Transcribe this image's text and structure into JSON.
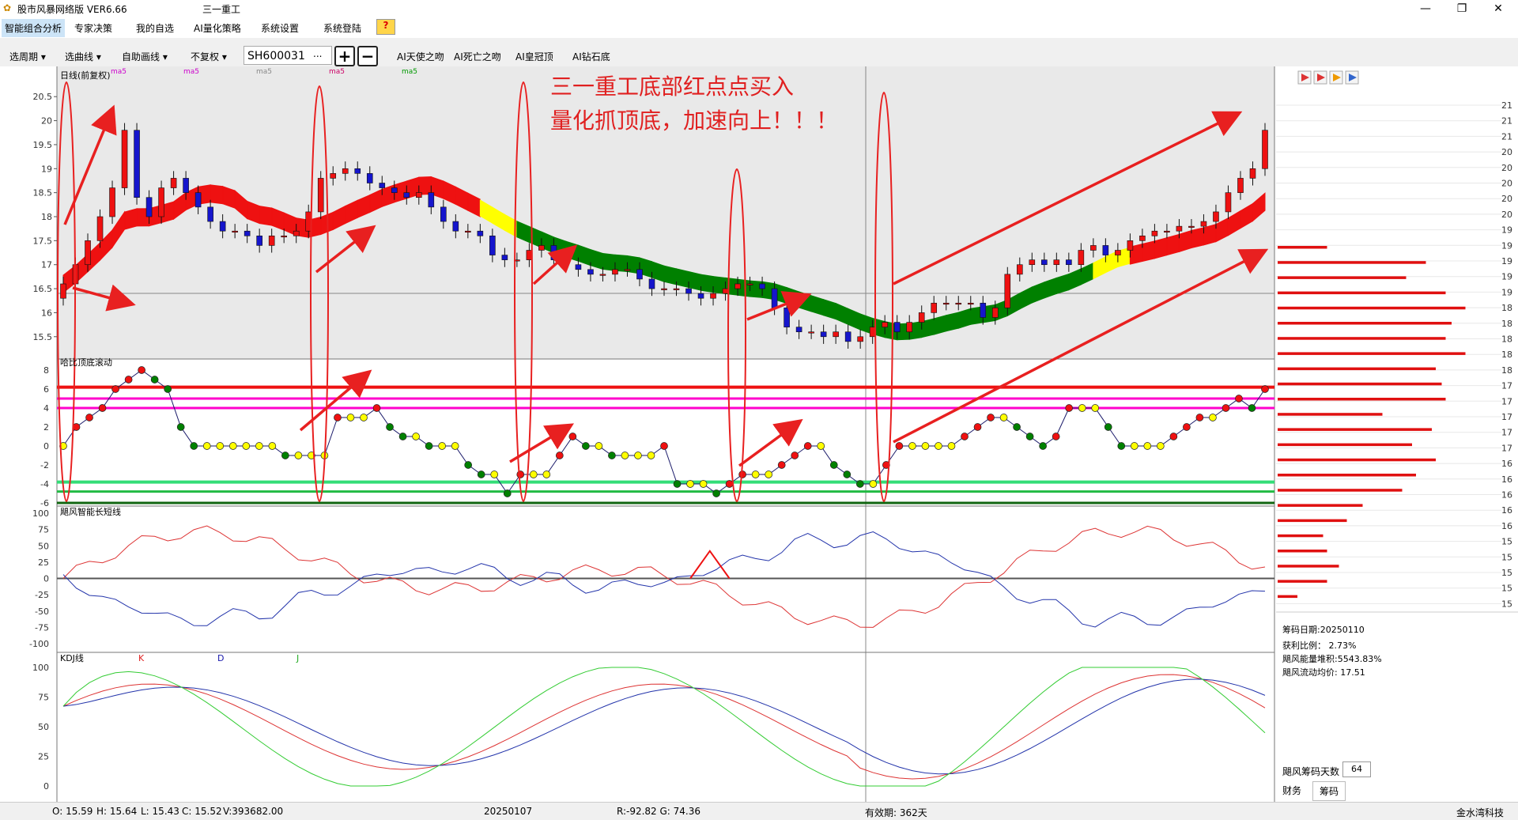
{
  "window": {
    "app_title": "股市风暴网络版 VER6.66",
    "doc_title": "三一重工",
    "min_glyph": "—",
    "max_glyph": "❐",
    "close_glyph": "✕"
  },
  "menu": {
    "items": [
      "智能组合分析",
      "专家决策",
      "我的自选",
      "AI量化策略",
      "系统设置",
      "系统登陆"
    ],
    "help": "?"
  },
  "toolbar": {
    "period": "选周期",
    "curve": "选曲线",
    "auto_draw": "自助画线",
    "adjust": "不复权",
    "stock_code": "SH600031",
    "more": "...",
    "plus": "+",
    "minus": "−",
    "ai_items": [
      "AI天使之吻",
      "AI死亡之吻",
      "AI皇冠顶",
      "AI钻石底"
    ],
    "dropdown_glyph": "▾"
  },
  "colors": {
    "red": "#ee1111",
    "green": "#008000",
    "yellow": "#ffff00",
    "blue": "#1515cc",
    "magenta": "#ff00cc",
    "accent": "#e02020"
  },
  "annotation": {
    "line1": "三一重工底部红点点买入",
    "line2": "量化抓顶底，加速向上！！！"
  },
  "chart_data": [
    {
      "type": "candlestick",
      "title": "日线(前复权)",
      "indicator_labels": [
        "ma5",
        "ma5",
        "ma5",
        "ma5",
        "ma5"
      ],
      "yticks": [
        "20.5",
        "20",
        "19.5",
        "19",
        "18.5",
        "18",
        "17.5",
        "17",
        "16.5",
        "16",
        "15.5"
      ],
      "ylim": [
        15.2,
        20.8
      ],
      "close": [
        16.6,
        17.0,
        17.5,
        18.0,
        18.6,
        19.8,
        18.4,
        18.0,
        18.6,
        18.8,
        18.5,
        18.2,
        17.9,
        17.7,
        17.7,
        17.6,
        17.4,
        17.6,
        17.6,
        17.7,
        18.1,
        18.8,
        18.9,
        19.0,
        18.9,
        18.7,
        18.6,
        18.5,
        18.4,
        18.5,
        18.2,
        17.9,
        17.7,
        17.7,
        17.6,
        17.2,
        17.1,
        17.1,
        17.3,
        17.4,
        17.1,
        17.0,
        16.9,
        16.8,
        16.8,
        16.9,
        16.9,
        16.7,
        16.5,
        16.5,
        16.5,
        16.4,
        16.3,
        16.4,
        16.5,
        16.6,
        16.6,
        16.5,
        16.1,
        15.7,
        15.6,
        15.6,
        15.5,
        15.6,
        15.4,
        15.5,
        15.7,
        15.8,
        15.6,
        15.8,
        16.0,
        16.2,
        16.2,
        16.2,
        16.2,
        15.9,
        16.1,
        16.8,
        17.0,
        17.1,
        17.0,
        17.1,
        17.0,
        17.3,
        17.4,
        17.2,
        17.3,
        17.5,
        17.6,
        17.7,
        17.7,
        17.8,
        17.8,
        17.9,
        18.1,
        18.5,
        18.8,
        19.0,
        19.8
      ],
      "dots_values": [
        0,
        2,
        3,
        4,
        6,
        7,
        8,
        7,
        6,
        2,
        0,
        0,
        0,
        0,
        0,
        0,
        0,
        -1,
        -1,
        -1,
        -1,
        3,
        3,
        3,
        4,
        2,
        1,
        1,
        0,
        0,
        0,
        -2,
        -3,
        -3,
        -5,
        -3,
        -3,
        -3,
        -1,
        1,
        0,
        0,
        -1,
        -1,
        -1,
        -1,
        0,
        -4,
        -4,
        -4,
        -5,
        -4,
        -3,
        -3,
        -3,
        -2,
        -1,
        0,
        0,
        -2,
        -3,
        -4,
        -4,
        -2,
        0,
        0,
        0,
        0,
        0,
        1,
        2,
        3,
        3,
        2,
        1,
        0,
        1,
        4,
        4,
        4,
        2,
        0,
        0,
        0,
        0,
        1,
        2,
        3,
        3,
        4,
        5,
        4,
        6
      ]
    }
  ],
  "subpanels": {
    "dots": {
      "title": "哈比顶底滚动",
      "yticks": [
        "8",
        "6",
        "4",
        "2",
        "0",
        "-2",
        "-4",
        "-6"
      ]
    },
    "wind": {
      "title": "飓风智能长短线",
      "yticks": [
        "100",
        "75",
        "50",
        "25",
        "0",
        "-25",
        "-50",
        "-75",
        "-100"
      ]
    },
    "kdj": {
      "title": "KDJ线",
      "k": "K",
      "d": "D",
      "j": "J",
      "yticks": [
        "100",
        "75",
        "50",
        "25",
        "0"
      ]
    }
  },
  "right_panel": {
    "price_labels": [
      "21",
      "21",
      "21",
      "20",
      "20",
      "20",
      "20",
      "20",
      "19",
      "19",
      "19",
      "19",
      "19",
      "18",
      "18",
      "18",
      "18",
      "18",
      "17",
      "17",
      "17",
      "17",
      "17",
      "16",
      "16",
      "16",
      "16",
      "16",
      "15",
      "15",
      "15",
      "15",
      "15"
    ],
    "bar_ratios": [
      0.25,
      0.75,
      0.65,
      0.85,
      0.95,
      0.88,
      0.85,
      0.95,
      0.8,
      0.83,
      0.85,
      0.53,
      0.78,
      0.68,
      0.8,
      0.7,
      0.63,
      0.43,
      0.35,
      0.23,
      0.25,
      0.31,
      0.25,
      0.1
    ],
    "info": {
      "date": "筹码日期:20250110",
      "profit_label": "获利比例：",
      "profit_value": "2.73%",
      "energy": "飓风能量堆积:5543.83%",
      "avg": "飓风流动均价: 17.51",
      "days_label": "飓风筹码天数",
      "days_value": "64",
      "tab1": "财务",
      "tab2": "筹码"
    }
  },
  "status": {
    "o": "O: 15.59",
    "h": "H: 15.64",
    "l": "L: 15.43",
    "c": "C: 15.52",
    "v": "V:393682.00",
    "date": "20250107",
    "rg": "R:-92.82  G: 74.36",
    "valid": "有效期:  362天",
    "company": "金水湾科技"
  }
}
